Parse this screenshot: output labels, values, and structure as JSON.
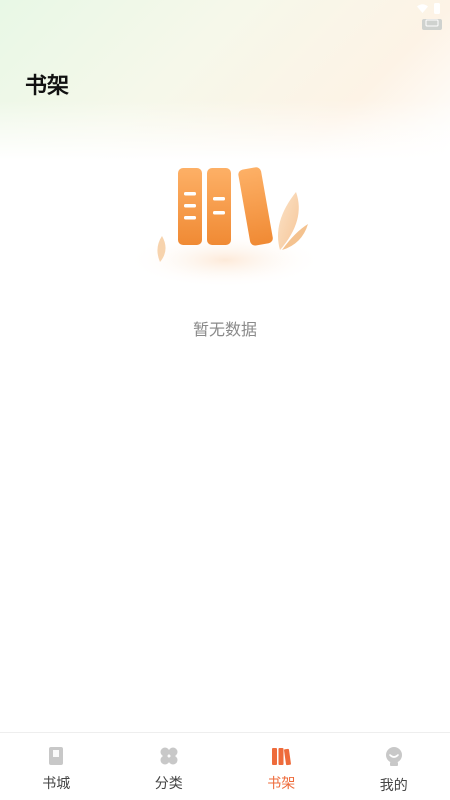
{
  "header": {
    "title": "书架"
  },
  "empty_state": {
    "icon": "bookshelf-illustration",
    "message": "暂无数据"
  },
  "tabbar": {
    "items": [
      {
        "label": "书城",
        "icon": "book-icon",
        "active": false
      },
      {
        "label": "分类",
        "icon": "category-grid-icon",
        "active": false
      },
      {
        "label": "书架",
        "icon": "bookshelf-icon",
        "active": true
      },
      {
        "label": "我的",
        "icon": "profile-icon",
        "active": false
      }
    ]
  },
  "colors": {
    "accent": "#ee6b3b",
    "inactive_icon": "#c8c8c8",
    "title": "#111111"
  }
}
